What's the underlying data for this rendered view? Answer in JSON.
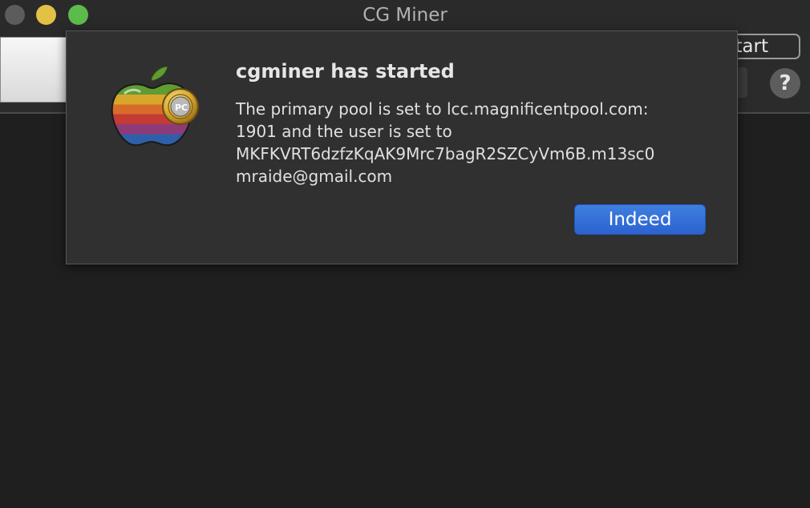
{
  "window": {
    "title": "CG Miner",
    "traffic_lights": {
      "close_color": "#5d5c5d",
      "minimize_color": "#e3c145",
      "zoom_color": "#5cbc4b"
    }
  },
  "toolbar": {
    "start_label": "tart",
    "help_label": "?"
  },
  "alert": {
    "icon": "apple-bitcoin-app-icon",
    "title": "cgminer has started",
    "message_lines": [
      "The primary pool is set to lcc.magnificentpool.com:",
      "1901 and the user is set to",
      "MKFKVRT6dzfzKqAK9Mrc7bagR2SZCyVm6B.m13sc0",
      "mraide@gmail.com"
    ],
    "button_label": "Indeed",
    "accent": "#2c62cf"
  }
}
